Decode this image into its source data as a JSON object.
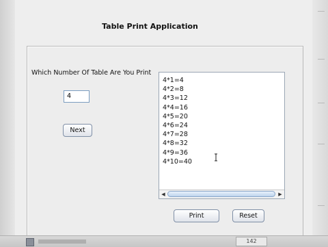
{
  "window": {
    "title": "Table Print Application"
  },
  "form": {
    "prompt_label": "Which Number Of Table Are You Print",
    "number_value": "4",
    "next_label": "Next",
    "print_label": "Print",
    "reset_label": "Reset"
  },
  "output": {
    "lines": [
      "4*1=4",
      "4*2=8",
      "4*3=12",
      "4*4=16",
      "4*5=20",
      "4*6=24",
      "4*7=28",
      "4*8=32",
      "4*9=36",
      "4*10=40"
    ]
  },
  "taskbar": {
    "number": "142"
  },
  "colors": {
    "window_bg": "#eeeeee",
    "button_border": "#7f8fa6",
    "scroll_thumb": "#bcd3ec"
  }
}
